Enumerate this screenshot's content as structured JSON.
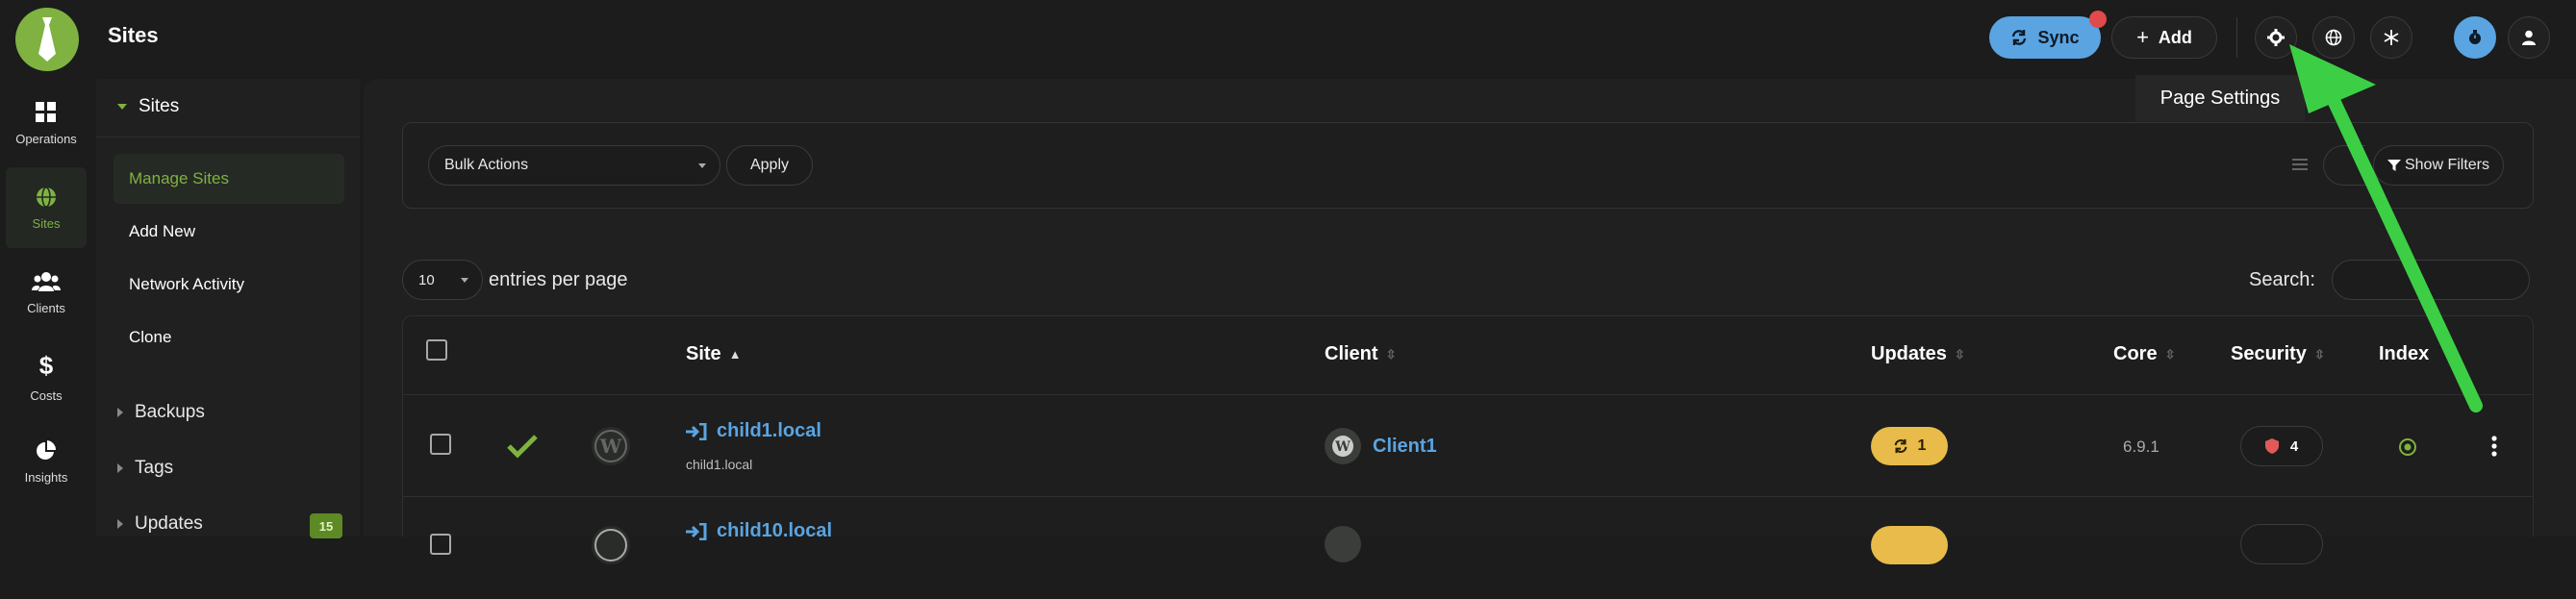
{
  "header": {
    "title": "Sites",
    "sync_label": "Sync",
    "add_label": "Add",
    "tooltip": "Page Settings"
  },
  "leftnav": [
    {
      "label": "Operations",
      "icon": "grid-icon"
    },
    {
      "label": "Sites",
      "icon": "globe-icon",
      "active": true
    },
    {
      "label": "Clients",
      "icon": "users-icon"
    },
    {
      "label": "Costs",
      "icon": "dollar-icon"
    },
    {
      "label": "Insights",
      "icon": "pie-chart-icon"
    }
  ],
  "subnav": {
    "section": "Sites",
    "items": [
      {
        "label": "Manage Sites",
        "active": true
      },
      {
        "label": "Add New"
      },
      {
        "label": "Network Activity"
      },
      {
        "label": "Clone"
      }
    ],
    "groups": [
      {
        "label": "Backups"
      },
      {
        "label": "Tags"
      },
      {
        "label": "Updates",
        "badge": "15"
      }
    ]
  },
  "toolbar": {
    "bulk_actions": "Bulk Actions",
    "apply": "Apply",
    "show_filters": "Show Filters"
  },
  "entries": {
    "value": "10",
    "label": "entries per page",
    "search_label": "Search:"
  },
  "table": {
    "columns": [
      "Site",
      "Client",
      "Updates",
      "Core",
      "Security",
      "Index"
    ],
    "rows": [
      {
        "site": "child1.local",
        "url": "child1.local",
        "client": "Client1",
        "updates": "1",
        "core": "6.9.1",
        "security": "4"
      },
      {
        "site": "child10.local"
      }
    ]
  },
  "colors": {
    "accent_green": "#7fb241",
    "link_blue": "#5aa4e2",
    "updates_yellow": "#e8bb4a",
    "arrow_green": "#3ccf45"
  }
}
